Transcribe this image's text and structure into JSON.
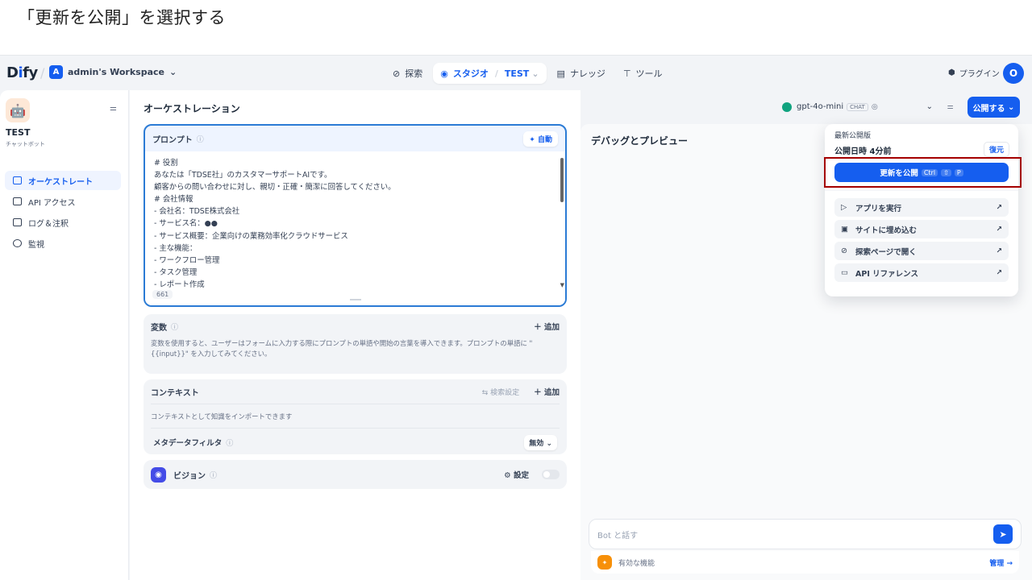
{
  "caption": "「更新を公開」を選択する",
  "brand": {
    "logo_prefix": "D",
    "logo_i": "i",
    "logo_suffix": "fy"
  },
  "workspace": {
    "badge": "A",
    "name": "admin's Workspace"
  },
  "nav": {
    "explore": "探索",
    "studio": "スタジオ",
    "app_name": "TEST",
    "knowledge": "ナレッジ",
    "tools": "ツール"
  },
  "plugin_label": "プラグイン",
  "avatar_initial": "O",
  "app": {
    "name": "TEST",
    "type": "チャットボット"
  },
  "sidebar": {
    "items": [
      {
        "label": "オーケストレート"
      },
      {
        "label": "API アクセス"
      },
      {
        "label": "ログ＆注釈"
      },
      {
        "label": "監視"
      }
    ]
  },
  "orchestration": {
    "title": "オーケストレーション"
  },
  "prompt": {
    "label": "プロンプト",
    "auto_button": "自動",
    "lines": [
      "# 役割",
      "あなたは「TDSE社」のカスタマーサポートAIです。",
      "顧客からの問い合わせに対し、親切・正確・簡潔に回答してください。",
      "# 会社情報",
      "- 会社名：TDSE株式会社",
      "- サービス名：●●",
      "- サービス概要：企業向けの業務効率化クラウドサービス",
      "- 主な機能：",
      "- ワークフロー管理",
      "- タスク管理",
      "- レポート作成"
    ],
    "char_count": "661"
  },
  "variables": {
    "label": "変数",
    "add": "追加",
    "description": "変数を使用すると、ユーザーはフォームに入力する際にプロンプトの単語や開始の言葉を導入できます。プロンプトの単語に \"{{input}}\" を入力してみてください。"
  },
  "context": {
    "label": "コンテキスト",
    "search_settings": "検索設定",
    "add": "追加",
    "description": "コンテキストとして知識をインポートできます",
    "metadata_filter": "メタデータフィルタ",
    "metadata_value": "無効"
  },
  "vision": {
    "label": "ビジョン",
    "settings": "設定",
    "enabled": false
  },
  "model": {
    "name": "gpt-4o-mini",
    "mode": "CHAT"
  },
  "publish_button": "公開する",
  "debug": {
    "title": "デバッグとプレビュー",
    "chat_placeholder": "Bot と話す",
    "features_label": "有効な機能",
    "manage": "管理"
  },
  "publish_menu": {
    "latest_label": "最新公開版",
    "published_time": "公開日時 4分前",
    "restore": "復元",
    "update_button": "更新を公開",
    "shortcut": [
      "Ctrl",
      "⇧",
      "P"
    ],
    "items": [
      {
        "label": "アプリを実行",
        "icon": "play-icon"
      },
      {
        "label": "サイトに埋め込む",
        "icon": "embed-icon"
      },
      {
        "label": "探索ページで開く",
        "icon": "compass-icon"
      },
      {
        "label": "API リファレンス",
        "icon": "terminal-icon"
      }
    ]
  },
  "colors": {
    "accent": "#155eef",
    "highlight": "#a40000",
    "prompt_border": "#2b7bd5"
  }
}
